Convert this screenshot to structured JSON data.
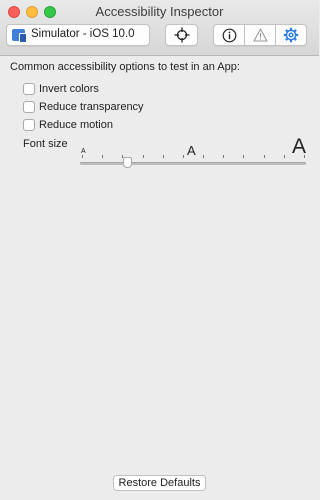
{
  "window": {
    "title": "Accessibility Inspector"
  },
  "toolbar": {
    "target_label": "Simulator - iOS 10.0",
    "icons": {
      "target": "simulator-icon",
      "pick": "crosshair-icon",
      "inspection": "info-icon",
      "audit": "warning-icon",
      "settings": "gear-icon"
    },
    "accent": "#2b7de0"
  },
  "settings": {
    "intro": "Common accessibility options to test in an App:",
    "options": [
      {
        "label": "Invert colors",
        "checked": false
      },
      {
        "label": "Reduce transparency",
        "checked": false
      },
      {
        "label": "Reduce motion",
        "checked": false
      }
    ],
    "font_size": {
      "label": "Font size",
      "small_glyph": "A",
      "mid_glyph": "A",
      "large_glyph": "A",
      "slider_fraction": 0.2
    },
    "restore_label": "Restore Defaults"
  }
}
